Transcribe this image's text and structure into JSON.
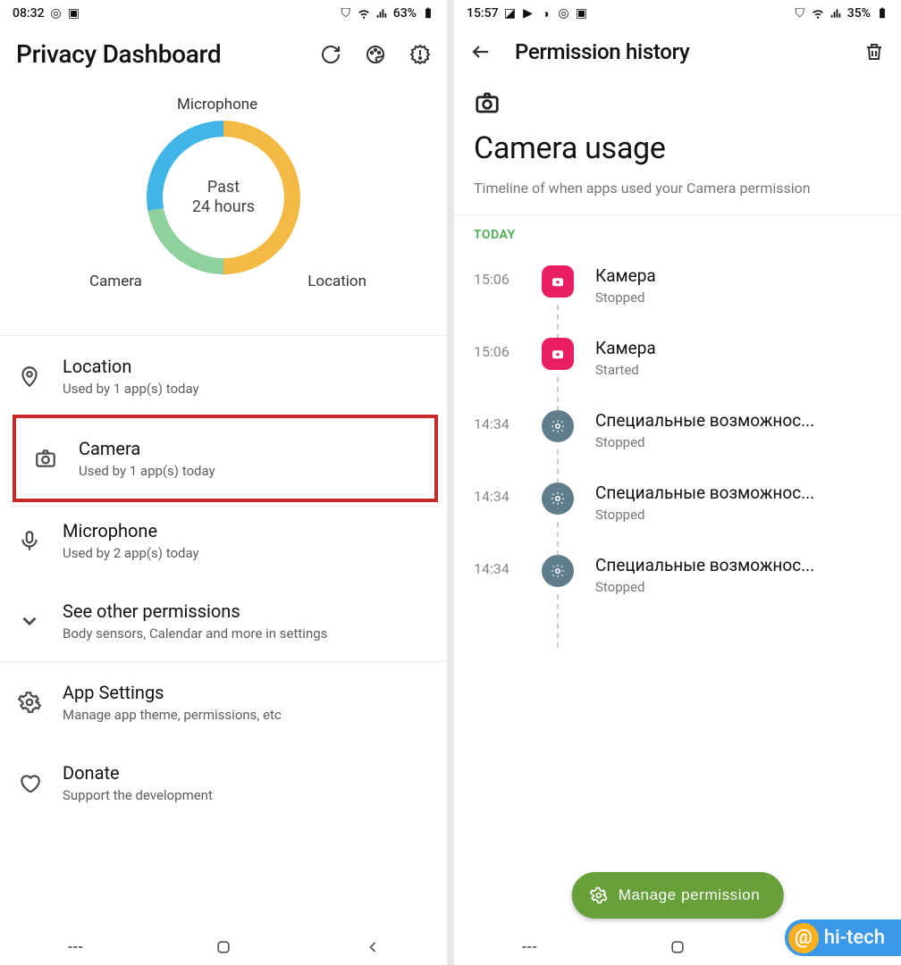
{
  "left": {
    "statusbar": {
      "time": "08:32",
      "battery": "63%"
    },
    "appbar": {
      "title": "Privacy Dashboard"
    },
    "donut": {
      "center_line1": "Past",
      "center_line2": "24 hours",
      "labels": {
        "mic": "Microphone",
        "cam": "Camera",
        "loc": "Location"
      },
      "colors": {
        "mic": "#f4b942",
        "cam": "#41b6e6",
        "loc": "#8fd19e"
      }
    },
    "rows": [
      {
        "title": "Location",
        "sub": "Used by 1 app(s) today",
        "icon": "location"
      },
      {
        "title": "Camera",
        "sub": "Used by 1 app(s) today",
        "icon": "camera"
      },
      {
        "title": "Microphone",
        "sub": "Used by 2 app(s) today",
        "icon": "mic"
      },
      {
        "title": "See other permissions",
        "sub": "Body sensors, Calendar and more in settings",
        "icon": "chevron"
      },
      {
        "title": "App Settings",
        "sub": "Manage app theme, permissions, etc",
        "icon": "gear"
      },
      {
        "title": "Donate",
        "sub": "Support the development",
        "icon": "heart"
      }
    ]
  },
  "right": {
    "statusbar": {
      "time": "15:57",
      "battery": "35%"
    },
    "appbar": {
      "title": "Permission history"
    },
    "header": {
      "title": "Camera usage",
      "sub": "Timeline of when apps used your Camera permission"
    },
    "section_label": "TODAY",
    "timeline": [
      {
        "time": "15:06",
        "app": "Камера",
        "status": "Stopped",
        "icon": "camera-app"
      },
      {
        "time": "15:06",
        "app": "Камера",
        "status": "Started",
        "icon": "camera-app"
      },
      {
        "time": "14:34",
        "app": "Специальные возможнос...",
        "status": "Stopped",
        "icon": "settings-app"
      },
      {
        "time": "14:34",
        "app": "Специальные возможнос...",
        "status": "Stopped",
        "icon": "settings-app"
      },
      {
        "time": "14:34",
        "app": "Специальные возможнос...",
        "status": "Stopped",
        "icon": "settings-app"
      }
    ],
    "fab": "Manage permission"
  },
  "watermark": "hi-tech",
  "chart_data": {
    "type": "pie",
    "title": "Past 24 hours",
    "categories": [
      "Microphone",
      "Location",
      "Camera"
    ],
    "values": [
      180,
      80,
      100
    ],
    "series": [
      {
        "name": "Microphone",
        "color": "#f4b942",
        "degrees": 180
      },
      {
        "name": "Location",
        "color": "#8fd19e",
        "degrees": 80
      },
      {
        "name": "Camera",
        "color": "#41b6e6",
        "degrees": 100
      }
    ]
  }
}
